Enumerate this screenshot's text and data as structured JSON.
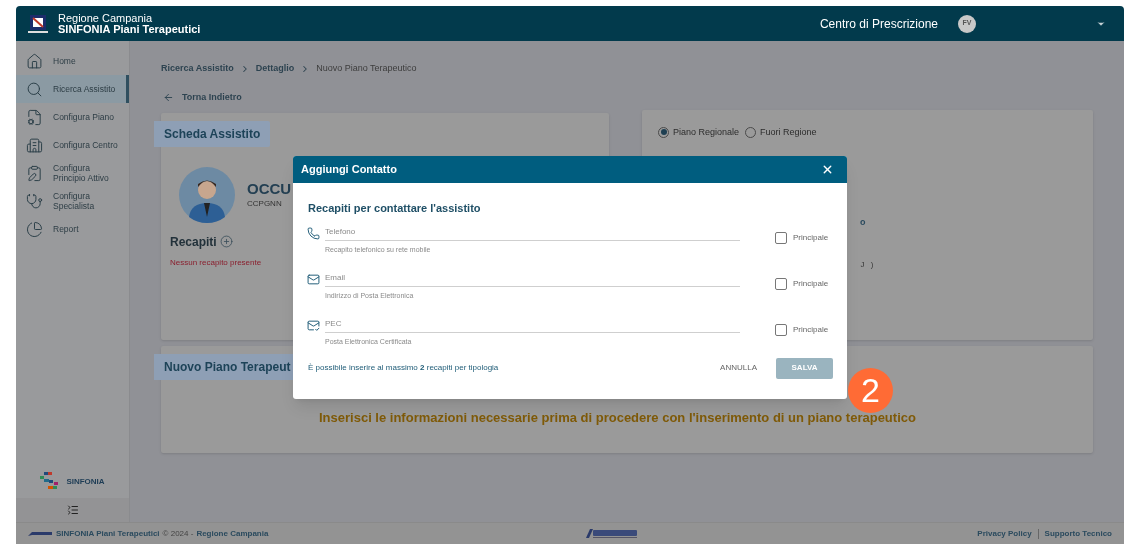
{
  "header": {
    "title_lines": [
      "Regione Campania",
      "SINFONIA Piani Terapeutici"
    ],
    "role": "Centro di Prescrizione",
    "avatar_initials": "FV"
  },
  "sidebar": {
    "items": [
      {
        "label": "Home",
        "selected": false
      },
      {
        "label": "Ricerca Assistito",
        "selected": true
      },
      {
        "label": "Configura Piano",
        "selected": false
      },
      {
        "label": "Configura Centro",
        "selected": false
      },
      {
        "label": "Configura Principio Attivo",
        "selected": false
      },
      {
        "label": "Configura Specialista",
        "selected": false
      },
      {
        "label": "Report",
        "selected": false
      }
    ],
    "brand": "SINFONIA"
  },
  "breadcrumbs": [
    "Ricerca Assistito",
    "Dettaglio",
    "Nuovo Piano Terapeutico"
  ],
  "back_link": "Torna Indietro",
  "patient_card": {
    "title": "Scheda Assistito",
    "name": "OCCU",
    "code": "CCPGNN",
    "contacts_label": "Recapiti",
    "empty_message": "Nessun recapito presente"
  },
  "plan_type": {
    "options": [
      {
        "label": "Piano Regionale",
        "selected": true
      },
      {
        "label": "Fuori Regione",
        "selected": false
      }
    ],
    "fragments": [
      "o",
      "J )"
    ]
  },
  "new_plan_card": {
    "title": "Nuovo Piano Terapeut",
    "message": "Inserisci le informazioni necessarie prima di procedere con l'inserimento di un piano terapeutico"
  },
  "modal": {
    "title": "Aggiungi Contatto",
    "subtitle": "Recapiti per contattare l'assistito",
    "fields": [
      {
        "kind": "phone",
        "placeholder": "Telefono",
        "helper": "Recapito telefonico su rete mobile",
        "checkbox_label": "Principale",
        "checked": false
      },
      {
        "kind": "email",
        "placeholder": "Email",
        "helper": "Indirizzo di Posta Elettronica",
        "checkbox_label": "Principale",
        "checked": false
      },
      {
        "kind": "pec",
        "placeholder": "PEC",
        "helper": "Posta Elettronica Certificata",
        "checkbox_label": "Principale",
        "checked": false
      }
    ],
    "note": "È possibile inserire al massimo **2** recapiti per tipologia",
    "cancel": "ANNULLA",
    "save": "SALVA",
    "save_disabled": true
  },
  "step_badge": "2",
  "footer": {
    "app_name": "SINFONIA Piani Terapeutici",
    "copyright": "© 2024 -",
    "region": "Regione Campania",
    "links": [
      "Privacy Policy",
      "Supporto Tecnico"
    ]
  }
}
